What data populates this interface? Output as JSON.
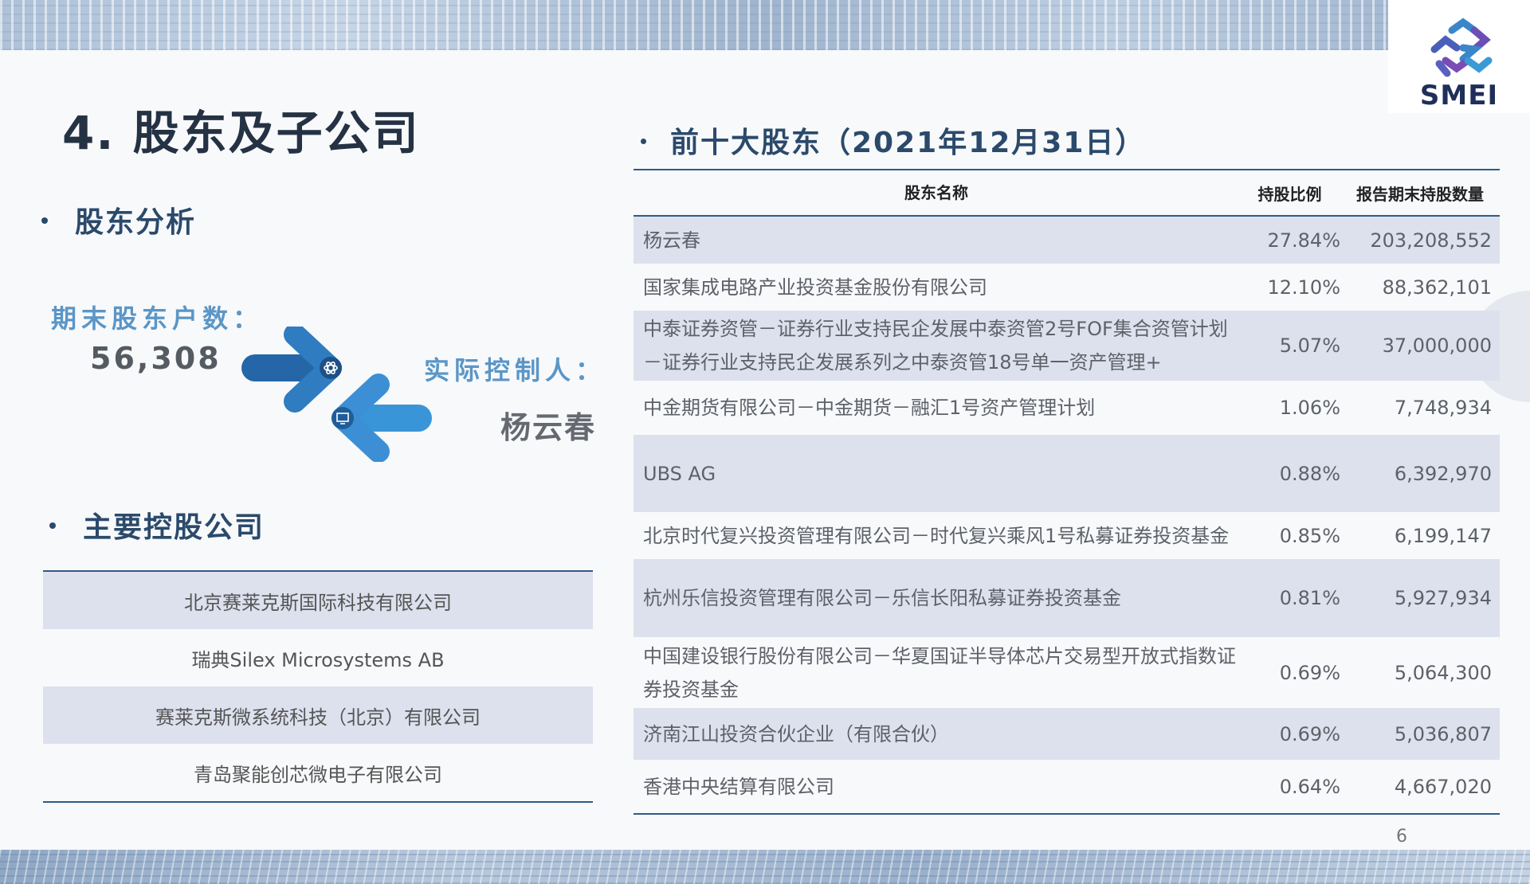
{
  "page": {
    "title": "4. 股东及子公司",
    "page_number": "6"
  },
  "logo": {
    "text": "SMEI"
  },
  "left": {
    "shareholder_analysis_heading": "股东分析",
    "holders_label": "期末股东户数：",
    "holders_count": "56,308",
    "controller_label": "实际控制人：",
    "controller_name": "杨云春",
    "subsidiaries_heading": "主要控股公司",
    "subsidiaries": [
      "北京赛莱克斯国际科技有限公司",
      "瑞典Silex Microsystems AB",
      "赛莱克斯微系统科技（北京）有限公司",
      "青岛聚能创芯微电子有限公司"
    ]
  },
  "right": {
    "heading": "前十大股东（2021年12月31日）",
    "columns": {
      "name": "股东名称",
      "pct": "持股比例",
      "qty": "报告期末持股数量"
    },
    "rows": [
      {
        "name": "杨云春",
        "pct": "27.84%",
        "qty": "203,208,552"
      },
      {
        "name": "国家集成电路产业投资基金股份有限公司",
        "pct": "12.10%",
        "qty": "88,362,101"
      },
      {
        "name": "中泰证券资管－证券行业支持民企发展中泰资管2号FOF集合资管计划－证券行业支持民企发展系列之中泰资管18号单一资产管理+",
        "pct": "5.07%",
        "qty": "37,000,000"
      },
      {
        "name": "中金期货有限公司－中金期货－融汇1号资产管理计划",
        "pct": "1.06%",
        "qty": "7,748,934"
      },
      {
        "name": "UBS AG",
        "pct": "0.88%",
        "qty": "6,392,970"
      },
      {
        "name": "北京时代复兴投资管理有限公司－时代复兴乘风1号私募证券投资基金",
        "pct": "0.85%",
        "qty": "6,199,147"
      },
      {
        "name": "杭州乐信投资管理有限公司－乐信长阳私募证券投资基金",
        "pct": "0.81%",
        "qty": "5,927,934"
      },
      {
        "name": "中国建设银行股份有限公司－华夏国证半导体芯片交易型开放式指数证券投资基金",
        "pct": "0.69%",
        "qty": "5,064,300"
      },
      {
        "name": "济南江山投资合伙企业（有限合伙）",
        "pct": "0.69%",
        "qty": "5,036,807"
      },
      {
        "name": "香港中央结算有限公司",
        "pct": "0.64%",
        "qty": "4,667,020"
      }
    ]
  }
}
